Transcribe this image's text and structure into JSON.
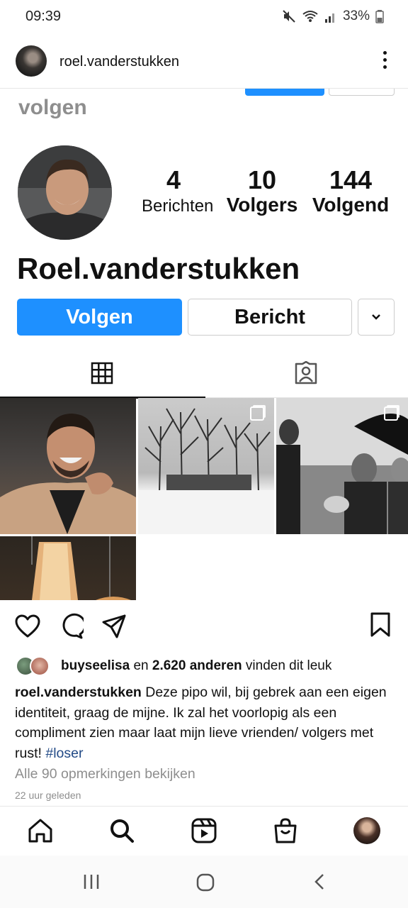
{
  "status_bar": {
    "time": "09:39",
    "battery": "33%",
    "icons": [
      "mute-icon",
      "wifi-icon",
      "signal-icon",
      "battery-icon"
    ]
  },
  "top_bar": {
    "username": "roel.vanderstukken",
    "more_icon": "more-vertical-icon"
  },
  "post_image": {
    "ghost_text": "volgen",
    "profile": {
      "posts_count": "4",
      "posts_label": "Berichten",
      "followers_count": "10",
      "followers_label": "Volgers",
      "following_count": "144",
      "following_label": "Volgend",
      "display_name": "Roel.vanderstukken"
    },
    "buttons": {
      "follow": "Volgen",
      "message": "Bericht",
      "dropdown_icon": "chevron-down-icon"
    },
    "tabs": [
      "grid-icon",
      "tagged-icon"
    ]
  },
  "post_actions": {
    "icons": [
      "heart-icon",
      "comment-icon",
      "share-icon",
      "bookmark-icon"
    ]
  },
  "likes": {
    "user": "buyseelisa",
    "connector": "en",
    "others": "2.620 anderen",
    "suffix": "vinden dit leuk"
  },
  "caption": {
    "username": "roel.vanderstukken",
    "text": "Deze pipo wil, bij gebrek aan een eigen identiteit, graag de mijne. Ik zal het voorlopig als een compliment zien maar laat mijn lieve vrienden/ volgers met rust!",
    "hashtag": "#loser"
  },
  "comments_link": "Alle 90 opmerkingen bekijken",
  "time_ago": "22 uur geleden",
  "bottom_nav": [
    "home-icon",
    "search-icon",
    "reels-icon",
    "shop-icon",
    "profile-avatar"
  ],
  "colors": {
    "accent_blue": "#1e90ff",
    "hashtag": "#224a86",
    "muted_text": "#8e8e8e"
  }
}
